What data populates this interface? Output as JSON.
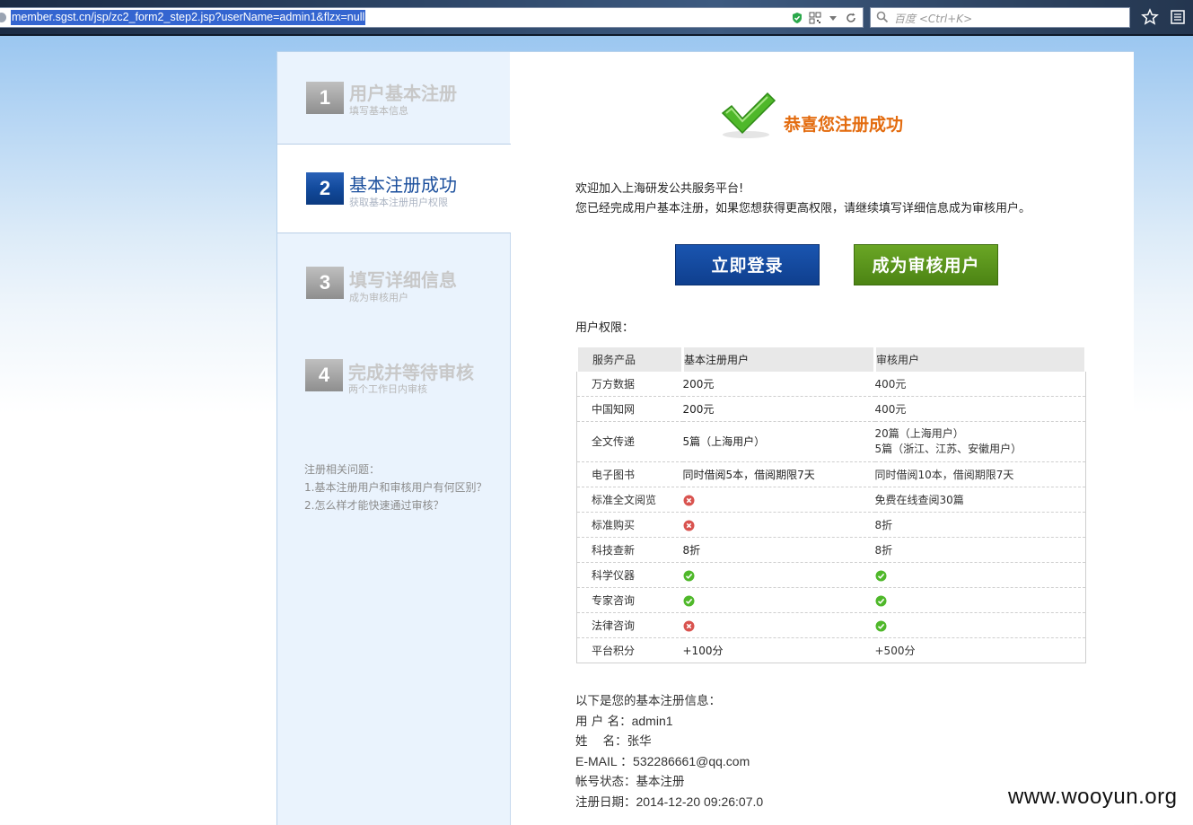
{
  "browser": {
    "url": "member.sgst.cn/jsp/zc2_form2_step2.jsp?userName=admin1&flzx=null",
    "search_placeholder": "百度 <Ctrl+K>"
  },
  "steps": [
    {
      "num": "1",
      "title": "用户基本注册",
      "subtitle": "填写基本信息"
    },
    {
      "num": "2",
      "title": "基本注册成功",
      "subtitle": "获取基本注册用户权限"
    },
    {
      "num": "3",
      "title": "填写详细信息",
      "subtitle": "成为审核用户"
    },
    {
      "num": "4",
      "title": "完成并等待审核",
      "subtitle": "两个工作日内审核"
    }
  ],
  "faq": {
    "title": "注册相关问题：",
    "items": [
      "1.基本注册用户和审核用户有何区别？",
      "2.怎么样才能快速通过审核？"
    ]
  },
  "success": {
    "title": "恭喜您注册成功",
    "welcome_line1": "欢迎加入上海研发公共服务平台!",
    "welcome_line2": "您已经完成用户基本注册，如果您想获得更高权限，请继续填写详细信息成为审核用户。"
  },
  "buttons": {
    "login": "立即登录",
    "audit": "成为审核用户"
  },
  "permissions": {
    "title": "用户权限：",
    "headers": [
      "服务产品",
      "基本注册用户",
      "审核用户"
    ],
    "rows": [
      {
        "service": "万方数据",
        "basic": "200元",
        "audited": "400元"
      },
      {
        "service": "中国知网",
        "basic": "200元",
        "audited": "400元"
      },
      {
        "service": "全文传递",
        "basic": "5篇（上海用户）",
        "audited": "20篇（上海用户）",
        "audited2": "5篇（浙江、江苏、安徽用户）"
      },
      {
        "service": "电子图书",
        "basic": "同时借阅5本，借阅期限7天",
        "audited": "同时借阅10本，借阅期限7天"
      },
      {
        "service": "标准全文阅览",
        "basic_icon": "cross-icon",
        "audited": "免费在线查阅30篇"
      },
      {
        "service": "标准购买",
        "basic_icon": "cross-icon",
        "audited": "8折"
      },
      {
        "service": "科技查新",
        "basic": "8折",
        "audited": "8折"
      },
      {
        "service": "科学仪器",
        "basic_icon": "check-icon",
        "audited_icon": "check-icon"
      },
      {
        "service": "专家咨询",
        "basic_icon": "check-icon",
        "audited_icon": "check-icon"
      },
      {
        "service": "法律咨询",
        "basic_icon": "cross-icon",
        "audited_icon": "check-icon"
      },
      {
        "service": "平台积分",
        "basic": "+100分",
        "audited": "+500分"
      }
    ]
  },
  "registration": {
    "title": "以下是您的基本注册信息：",
    "username_label": "用 户 名：",
    "username": "admin1",
    "name_label": "姓    名：",
    "name": "张华",
    "email_label": "E-MAIL ：",
    "email": "532286661@qq.com",
    "status_label": "帐号状态：",
    "status": "基本注册",
    "date_label": "注册日期：",
    "date": "2014-12-20 09:26:07.0"
  },
  "watermark": "www.wooyun.org",
  "colors": {
    "accent_blue": "#0f3f8e",
    "accent_green": "#4c8414",
    "success_orange": "#e36b0e",
    "check_green": "#4fb82a",
    "cross_red": "#d9534f"
  }
}
